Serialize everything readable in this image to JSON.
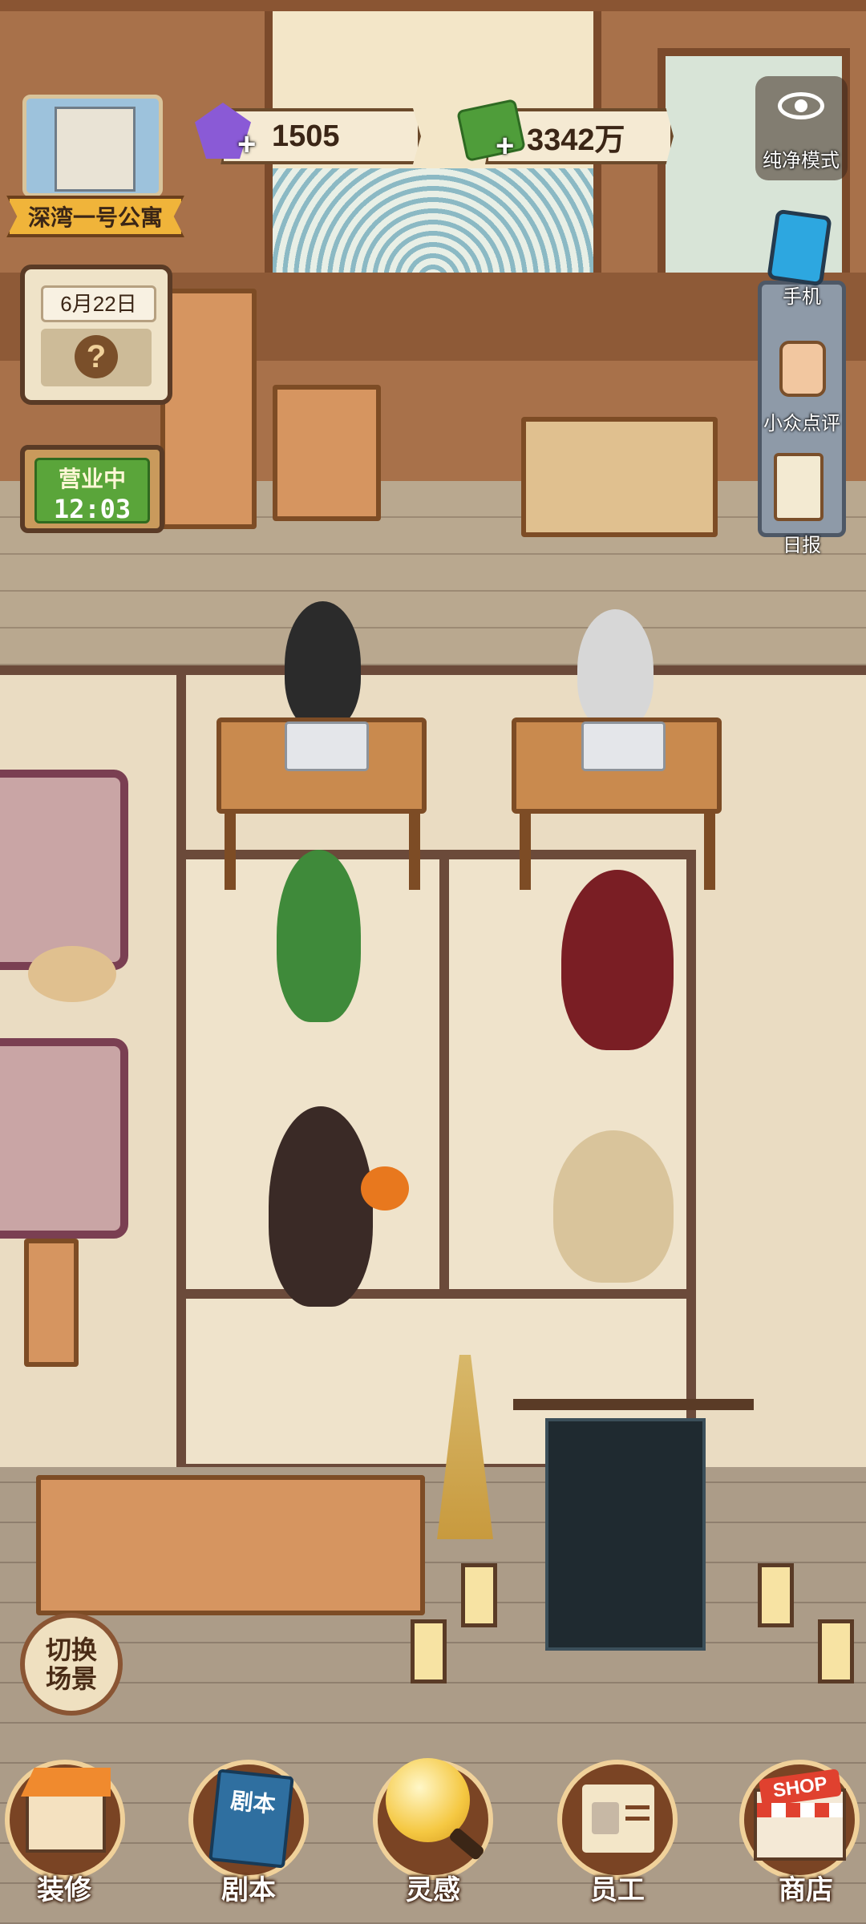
{
  "hud": {
    "building_name": "深湾一号公寓",
    "gems": "1505",
    "money": "3342万",
    "date": "6月22日",
    "weather_symbol": "?",
    "status": "营业中",
    "time": "12:03"
  },
  "side_menu": {
    "pure_mode": "纯净模式",
    "phone": "手机",
    "review": "小众点评",
    "daily": "日报"
  },
  "scene_switch": {
    "line1": "切换",
    "line2": "场景"
  },
  "bottom_nav": [
    {
      "label": "装修",
      "icon": "house-icon"
    },
    {
      "label": "剧本",
      "icon": "script-book-icon",
      "icon_text": "剧本"
    },
    {
      "label": "灵感",
      "icon": "lightbulb-magnifier-icon"
    },
    {
      "label": "员工",
      "icon": "staff-badge-icon"
    },
    {
      "label": "商店",
      "icon": "shop-icon",
      "icon_text": "SHOP"
    }
  ],
  "colors": {
    "accent_gold": "#f0b43a",
    "status_green": "#5aa53a",
    "wood": "#7d4c25",
    "gem_purple": "#8a5ad6",
    "money_green": "#4f9d3a"
  }
}
